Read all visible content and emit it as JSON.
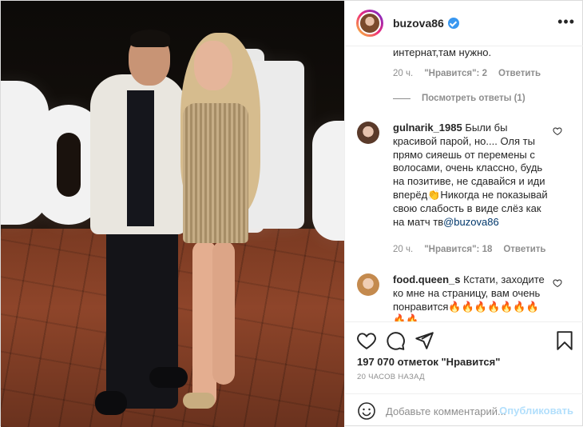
{
  "post": {
    "username": "buzova86",
    "verified": true,
    "more_icon": "more-horizontal-icon"
  },
  "comments": {
    "first_tail": {
      "text": "интернат,там нужно.",
      "time": "20 ч.",
      "likes": "\"Нравится\": 2",
      "reply": "Ответить"
    },
    "view_replies": "Посмотреть ответы (1)",
    "items": [
      {
        "username": "gulnarik_1985",
        "text": "Были бы красивой парой, но.... Оля ты прямо сияешь от перемены с волосами, очень классно, будь на позитиве, не сдавайся и иди вперёд👏Никогда не показывай свою слабость в виде слёз как на матч тв",
        "mention": "@buzova86",
        "time": "20 ч.",
        "likes": "\"Нравится\": 18",
        "reply": "Ответить"
      },
      {
        "username": "food.queen_s",
        "text": "Кстати, заходите ко мне на страницу, вам очень понравится🔥🔥🔥🔥🔥🔥🔥🔥🔥"
      }
    ]
  },
  "actions": {
    "like_icon": "heart-icon",
    "comment_icon": "comment-icon",
    "share_icon": "share-icon",
    "save_icon": "bookmark-icon",
    "likes_count": "197 070 отметок \"Нравится\"",
    "time_ago": "20 ЧАСОВ НАЗАД"
  },
  "add_comment": {
    "placeholder": "Добавьте комментарий...",
    "publish_label": "Опубликовать",
    "emoji_icon": "emoji-icon"
  },
  "colors": {
    "verified_blue": "#3897f0",
    "mention_blue": "#00376b",
    "publish_disabled": "#b2dffc",
    "muted_text": "#8e8e8e"
  }
}
